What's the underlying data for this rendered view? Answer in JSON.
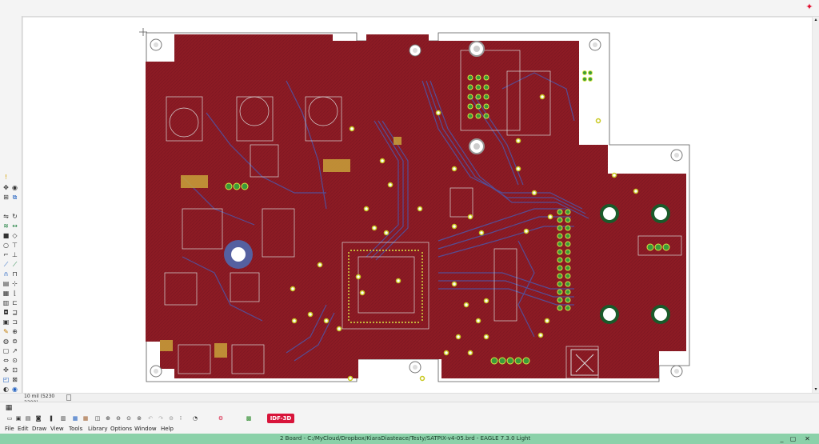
{
  "window": {
    "status_text": "2 Board - C:/MyCloud/Dropbox/KiaraDiasteace/Testy/SATPIX-v4-05.brd - EAGLE 7.3.0 Light",
    "controls": [
      "_",
      "▢",
      "✕"
    ]
  },
  "canvas": {
    "coordinate_readout": "10 mil (5230 3300)"
  },
  "toolbar": {
    "idf_button": "IDF-3D"
  },
  "menu": {
    "items": [
      "File",
      "Edit",
      "Draw",
      "View",
      "Tools",
      "Library",
      "Options",
      "Window",
      "Help"
    ]
  },
  "colors": {
    "board_copper": "#8c1b24",
    "trace_blue": "#4d56a8",
    "status_bar": "#8bd1a9",
    "idf_button": "#d8143a"
  }
}
